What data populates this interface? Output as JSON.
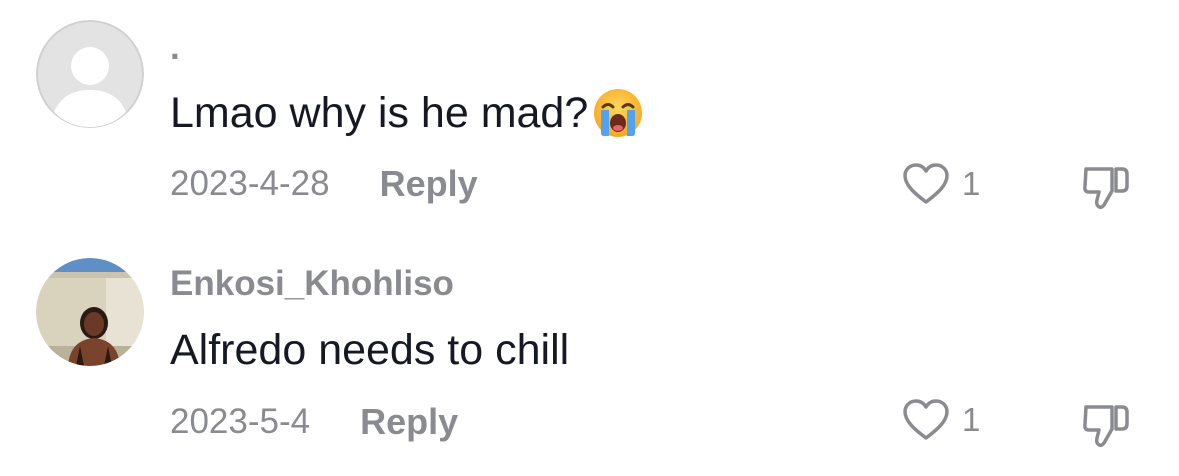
{
  "comments": [
    {
      "username": ".",
      "avatar": "default-avatar",
      "text": "Lmao why is he mad?",
      "emoji": "loudly-crying-face",
      "date": "2023-4-28",
      "reply_label": "Reply",
      "like_count": "1",
      "like_icon": "heart-outline-icon",
      "dislike_icon": "thumbs-down-icon"
    },
    {
      "username": "Enkosi_Khohliso",
      "avatar": "photo-avatar",
      "text": "Alfredo needs to chill",
      "date": "2023-5-4",
      "reply_label": "Reply",
      "like_count": "1",
      "like_icon": "heart-outline-icon",
      "dislike_icon": "thumbs-down-icon"
    }
  ],
  "colors": {
    "primary_text": "#161823",
    "secondary_text": "#8a8b91",
    "background": "#ffffff"
  }
}
